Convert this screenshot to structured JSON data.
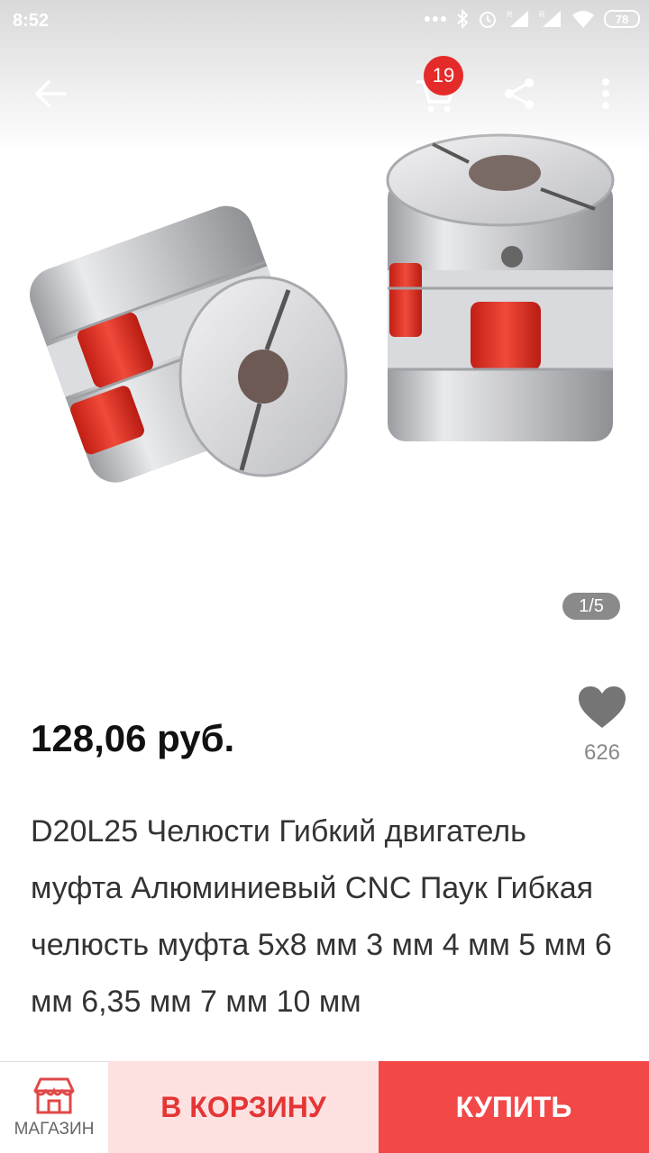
{
  "status_bar": {
    "time": "8:52",
    "battery": "78",
    "icons": [
      "dots-icon",
      "bluetooth-icon",
      "alarm-icon",
      "signal-icon",
      "signal-icon",
      "wifi-icon",
      "battery-icon"
    ]
  },
  "app_bar": {
    "icons": [
      "back-arrow-icon",
      "cart-icon",
      "share-icon",
      "more-vertical-icon"
    ],
    "cart_badge": "19"
  },
  "gallery": {
    "pager": "1/5"
  },
  "product": {
    "price": "128,06 руб.",
    "wishlist_count": "626",
    "title": "D20L25 Челюсти Гибкий двигатель муфта Алюминиевый CNC Паук Гибкая челюсть муфта 5x8 мм 3 мм 4 мм 5 мм 6 мм 6,35 мм 7 мм 10 мм"
  },
  "bottom_bar": {
    "store_label": "МАГАЗИН",
    "add_to_cart_label": "В КОРЗИНУ",
    "buy_label": "КУПИТЬ"
  },
  "colors": {
    "accent": "#f24848",
    "badge": "#e52a2a",
    "add_to_cart_bg": "#fde1e1",
    "coupling_red": "#e8382a",
    "metal": "#d4d4d6"
  }
}
